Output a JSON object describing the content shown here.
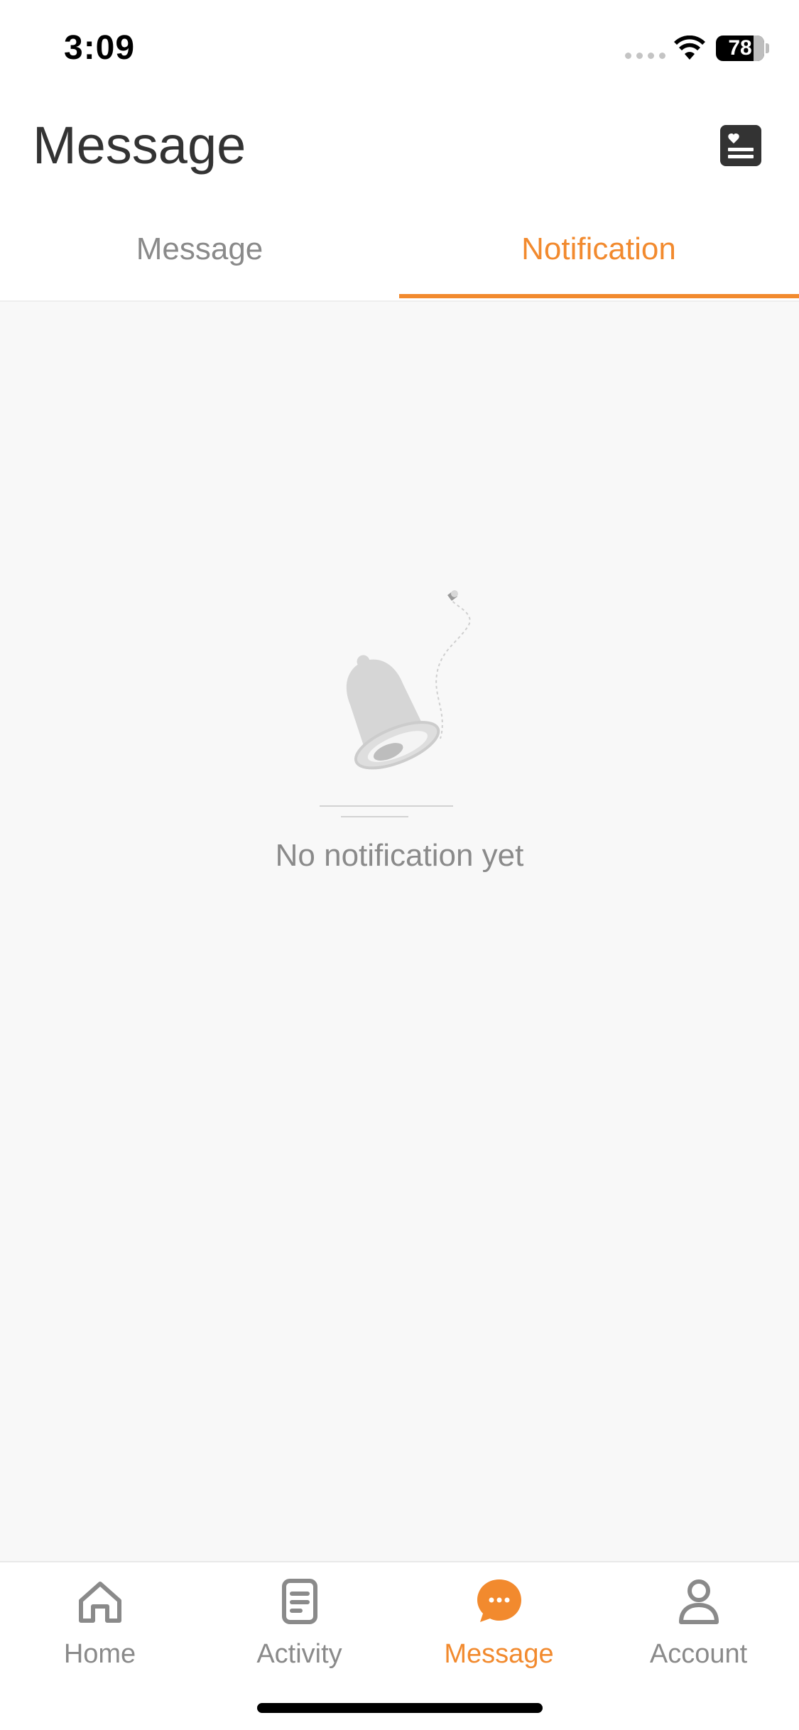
{
  "status_bar": {
    "time": "3:09",
    "battery": "78",
    "battery_level": 0.78
  },
  "header": {
    "title": "Message",
    "action_icon": "heart-list-icon"
  },
  "tabs": [
    {
      "label": "Message",
      "active": false
    },
    {
      "label": "Notification",
      "active": true
    }
  ],
  "empty_state": {
    "text": "No notification yet",
    "icon": "bell-icon"
  },
  "bottom_nav": [
    {
      "label": "Home",
      "icon": "home-icon",
      "active": false
    },
    {
      "label": "Activity",
      "icon": "document-icon",
      "active": false
    },
    {
      "label": "Message",
      "icon": "chat-bubble-icon",
      "active": true
    },
    {
      "label": "Account",
      "icon": "person-icon",
      "active": false
    }
  ],
  "colors": {
    "accent": "#f28a2e",
    "inactive": "#8a8a8a",
    "background": "#f8f8f8"
  }
}
